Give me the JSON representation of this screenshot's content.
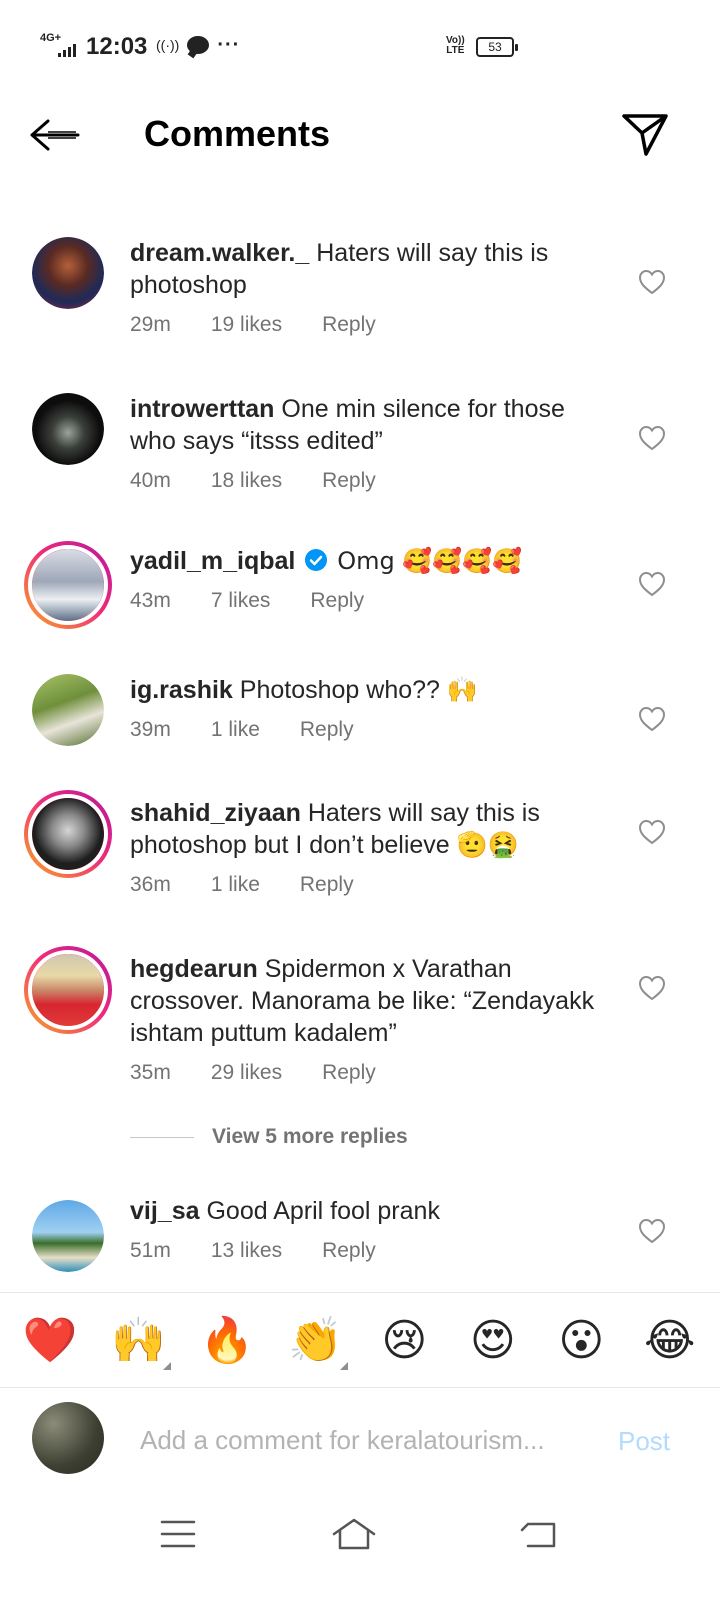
{
  "status_bar": {
    "network": "4G+",
    "time": "12:03",
    "volte": "Vo)) LTE",
    "battery": "53"
  },
  "header": {
    "title": "Comments",
    "back_icon": "arrow-left-icon",
    "send_icon": "paper-plane-icon"
  },
  "comments": [
    {
      "username": "dream.walker._",
      "text": "Haters will say this is photoshop",
      "time": "29m",
      "likes": "19 likes",
      "reply": "Reply",
      "verified": false
    },
    {
      "username": "introwerttan",
      "text": "One min silence for those who says “itsss edited”",
      "time": "40m",
      "likes": "18 likes",
      "reply": "Reply",
      "verified": false
    },
    {
      "username": "yadil_m_iqbal",
      "text": "Omg 🥰🥰🥰🥰",
      "time": "43m",
      "likes": "7 likes",
      "reply": "Reply",
      "verified": true
    },
    {
      "username": "ig.rashik",
      "text": "Photoshop who?? 🙌",
      "time": "39m",
      "likes": "1 like",
      "reply": "Reply",
      "verified": false
    },
    {
      "username": "shahid_ziyaan",
      "text": "Haters will say this is photoshop but I don’t believe 🫡🤮",
      "time": "36m",
      "likes": "1 like",
      "reply": "Reply",
      "verified": false
    },
    {
      "username": "hegdearun",
      "text": "Spidermon x Varathan crossover. Manorama be like: “Zendayakk ishtam puttum kadalem”",
      "time": "35m",
      "likes": "29 likes",
      "reply": "Reply",
      "verified": false
    },
    {
      "username": "vij_sa",
      "text": "Good April fool prank",
      "time": "51m",
      "likes": "13 likes",
      "reply": "Reply",
      "verified": false
    }
  ],
  "view_more": "View 5 more replies",
  "reactions": [
    "❤️",
    "🙌",
    "🔥",
    "👏",
    "😢",
    "😍",
    "😮",
    "😂"
  ],
  "composer": {
    "placeholder": "Add a comment for keralatourism...",
    "post_label": "Post",
    "post_color": "#b3dbff"
  },
  "nav": {
    "menu_icon": "menu-icon",
    "home_icon": "home-icon",
    "back_icon": "back-icon"
  },
  "colors": {
    "text": "#262626",
    "secondary": "#737373",
    "verified": "#0095f6",
    "like_outline": "#8e8e8e"
  }
}
